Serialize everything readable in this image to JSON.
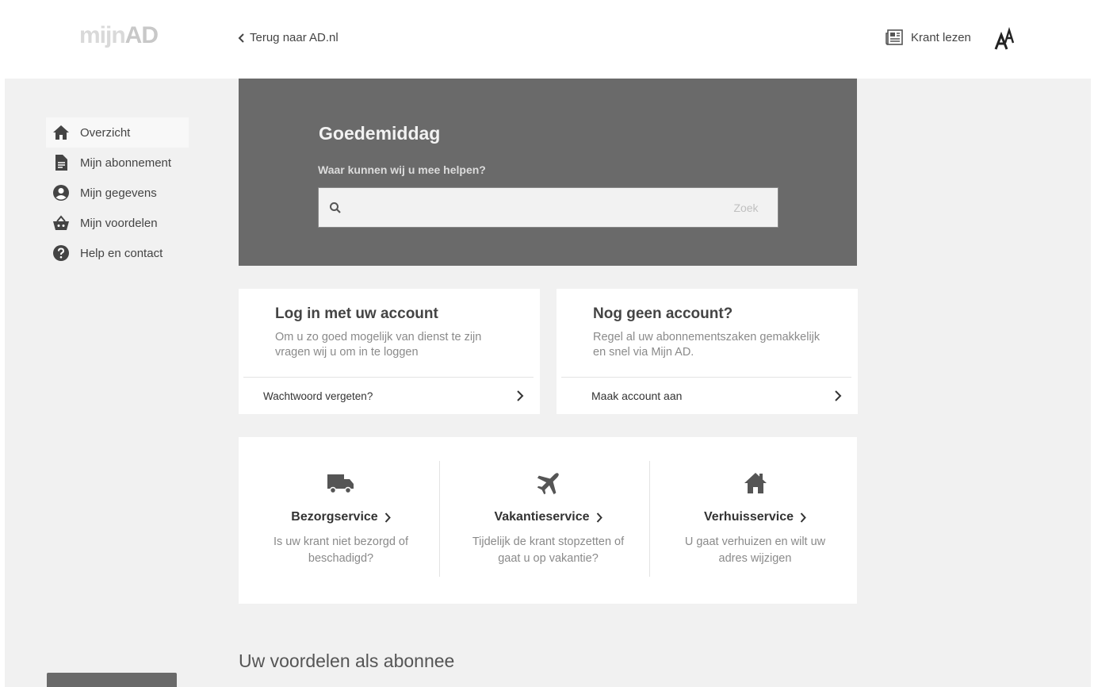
{
  "header": {
    "logo_prefix": "mijn",
    "logo_suffix": "AD",
    "back_label": "Terug naar AD.nl",
    "krant_label": "Krant lezen"
  },
  "sidebar": {
    "items": [
      {
        "label": "Overzicht",
        "icon": "home-icon",
        "active": true
      },
      {
        "label": "Mijn abonnement",
        "icon": "document-icon"
      },
      {
        "label": "Mijn gegevens",
        "icon": "user-circle-icon"
      },
      {
        "label": "Mijn voordelen",
        "icon": "basket-icon"
      },
      {
        "label": "Help en contact",
        "icon": "question-icon"
      }
    ]
  },
  "hero": {
    "greeting": "Goedemiddag",
    "question": "Waar kunnen wij u mee helpen?",
    "search_placeholder": "",
    "search_button": "Zoek"
  },
  "login_card": {
    "title": "Log in met uw account",
    "text": "Om u zo goed mogelijk van dienst te zijn vragen wij u om in te loggen",
    "link": "Wachtwoord vergeten?"
  },
  "new_card": {
    "title": "Nog geen account?",
    "text": "Regel al uw abonnementszaken gemakkelijk en snel via Mijn AD.",
    "link": "Maak account aan"
  },
  "services": [
    {
      "title": "Bezorgservice",
      "desc": "Is uw krant niet bezorgd of beschadigd?",
      "icon": "truck-icon"
    },
    {
      "title": "Vakantieservice",
      "desc": "Tijdelijk de krant stopzetten of gaat u op vakantie?",
      "icon": "plane-icon"
    },
    {
      "title": "Verhuisservice",
      "desc": "U gaat verhuizen en wilt uw adres wijzigen",
      "icon": "house-icon"
    }
  ],
  "benefits_title": "Uw voordelen als abonnee",
  "colors": {
    "background": "#f1f1f1",
    "hero": "#6a6a6a",
    "text": "#333333"
  }
}
